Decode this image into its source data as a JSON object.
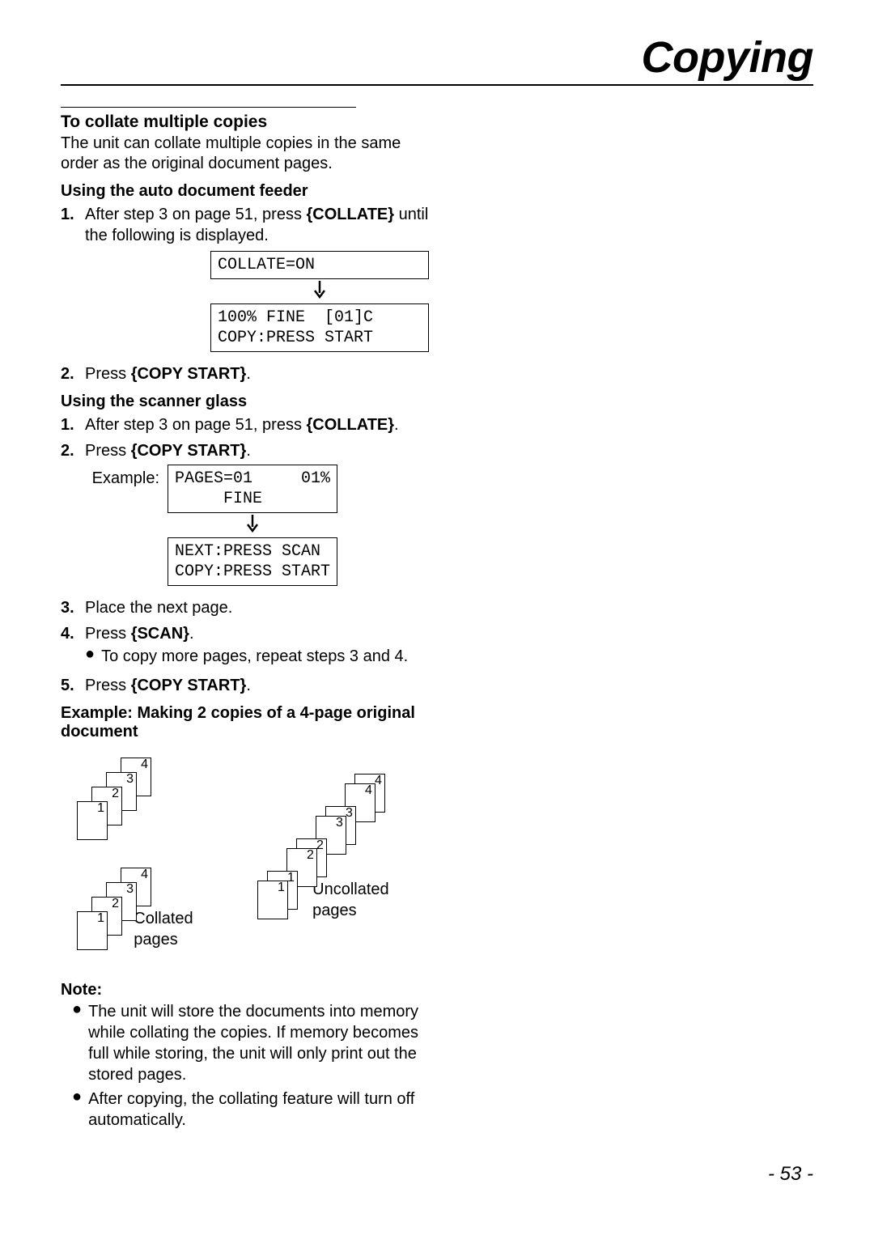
{
  "title": "Copying",
  "section": {
    "heading": "To collate multiple copies",
    "intro": "The unit can collate multiple copies in the same order as the original document pages."
  },
  "adf": {
    "heading": "Using the auto document feeder",
    "step1_num": "1.",
    "step1_text_before": "After step 3 on page 51, press ",
    "step1_key": "{COLLATE}",
    "step1_text_after": " until the following is displayed.",
    "lcd1": "COLLATE=ON",
    "lcd2a": "100% FINE  [01]C",
    "lcd2b": "COPY:PRESS START",
    "step2_num": "2.",
    "step2_text_before": "Press ",
    "step2_key": "{COPY START}",
    "step2_text_after": "."
  },
  "glass": {
    "heading": "Using the scanner glass",
    "step1_num": "1.",
    "step1_text_before": "After step 3 on page 51, press ",
    "step1_key": "{COLLATE}",
    "step1_text_after": ".",
    "step2_num": "2.",
    "step2_text_before": "Press ",
    "step2_key": "{COPY START}",
    "step2_text_after": ".",
    "example_label": "Example:",
    "lcd1a": "PAGES=01     01%",
    "lcd1b": "     FINE",
    "lcd2a": "NEXT:PRESS SCAN",
    "lcd2b": "COPY:PRESS START",
    "step3_num": "3.",
    "step3_text": "Place the next page.",
    "step4_num": "4.",
    "step4_text_before": "Press ",
    "step4_key": "{SCAN}",
    "step4_text_after": ".",
    "step4_bullet": "To copy more pages, repeat steps 3 and 4.",
    "step5_num": "5.",
    "step5_text_before": "Press ",
    "step5_key": "{COPY START}",
    "step5_text_after": "."
  },
  "example": {
    "heading": "Example: Making 2 copies of a 4-page original document",
    "collated_label": "Collated pages",
    "uncollated_label": "Uncollated pages",
    "pages": [
      "1",
      "2",
      "3",
      "4"
    ]
  },
  "note": {
    "heading": "Note:",
    "b1": "The unit will store the documents into memory while collating the copies. If memory becomes full while storing, the unit will only print out the stored pages.",
    "b2": "After copying, the collating feature will turn off automatically."
  },
  "pagenum": "- 53 -"
}
